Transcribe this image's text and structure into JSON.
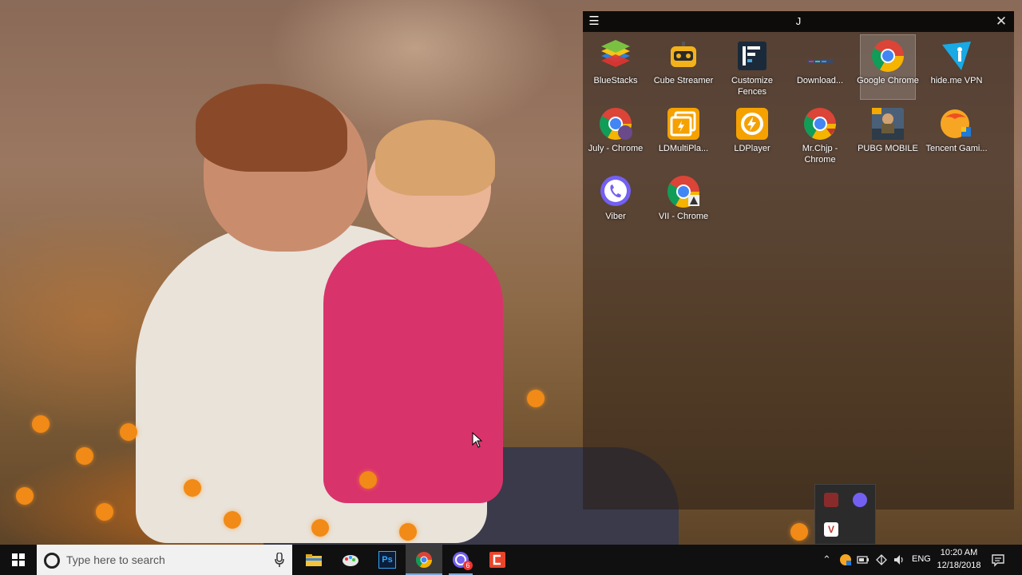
{
  "fence": {
    "title": "J",
    "icons": [
      {
        "label": "BlueStacks",
        "icon": "bluestacks-icon"
      },
      {
        "label": "Cube Streamer",
        "icon": "cube-streamer-icon"
      },
      {
        "label": "Customize Fences",
        "icon": "fences-icon"
      },
      {
        "label": "Download...",
        "icon": "download-shortcut-icon"
      },
      {
        "label": "Google Chrome",
        "icon": "chrome-icon",
        "selected": true
      },
      {
        "label": "hide.me VPN",
        "icon": "hideme-vpn-icon"
      },
      {
        "label": "July - Chrome",
        "icon": "chrome-profile-icon"
      },
      {
        "label": "LDMultiPla...",
        "icon": "ldmultiplayer-icon"
      },
      {
        "label": "LDPlayer",
        "icon": "ldplayer-icon"
      },
      {
        "label": "Mr.Chjp - Chrome",
        "icon": "chrome-profile-icon"
      },
      {
        "label": "PUBG MOBILE",
        "icon": "pubg-mobile-icon"
      },
      {
        "label": "Tencent Gami...",
        "icon": "tencent-gaming-icon"
      },
      {
        "label": "Viber",
        "icon": "viber-icon"
      },
      {
        "label": "VII - Chrome",
        "icon": "chrome-profile-icon"
      }
    ]
  },
  "taskbar": {
    "search_placeholder": "Type here to search",
    "apps": [
      {
        "name": "file-explorer",
        "icon": "folder-icon"
      },
      {
        "name": "paint-3d",
        "icon": "paint-icon"
      },
      {
        "name": "photoshop",
        "icon": "photoshop-icon",
        "text": "Ps"
      },
      {
        "name": "chrome",
        "icon": "chrome-icon",
        "active": true
      },
      {
        "name": "viber",
        "icon": "viber-icon",
        "badge": "6"
      },
      {
        "name": "camstudio",
        "icon": "red-app-icon"
      }
    ],
    "language": "ENG",
    "time": "10:20 AM",
    "date": "12/18/2018"
  },
  "colors": {
    "taskbar_bg": "#101010",
    "fence_title_bg": "#0d0c0b",
    "accent": "#7aa7d8"
  }
}
